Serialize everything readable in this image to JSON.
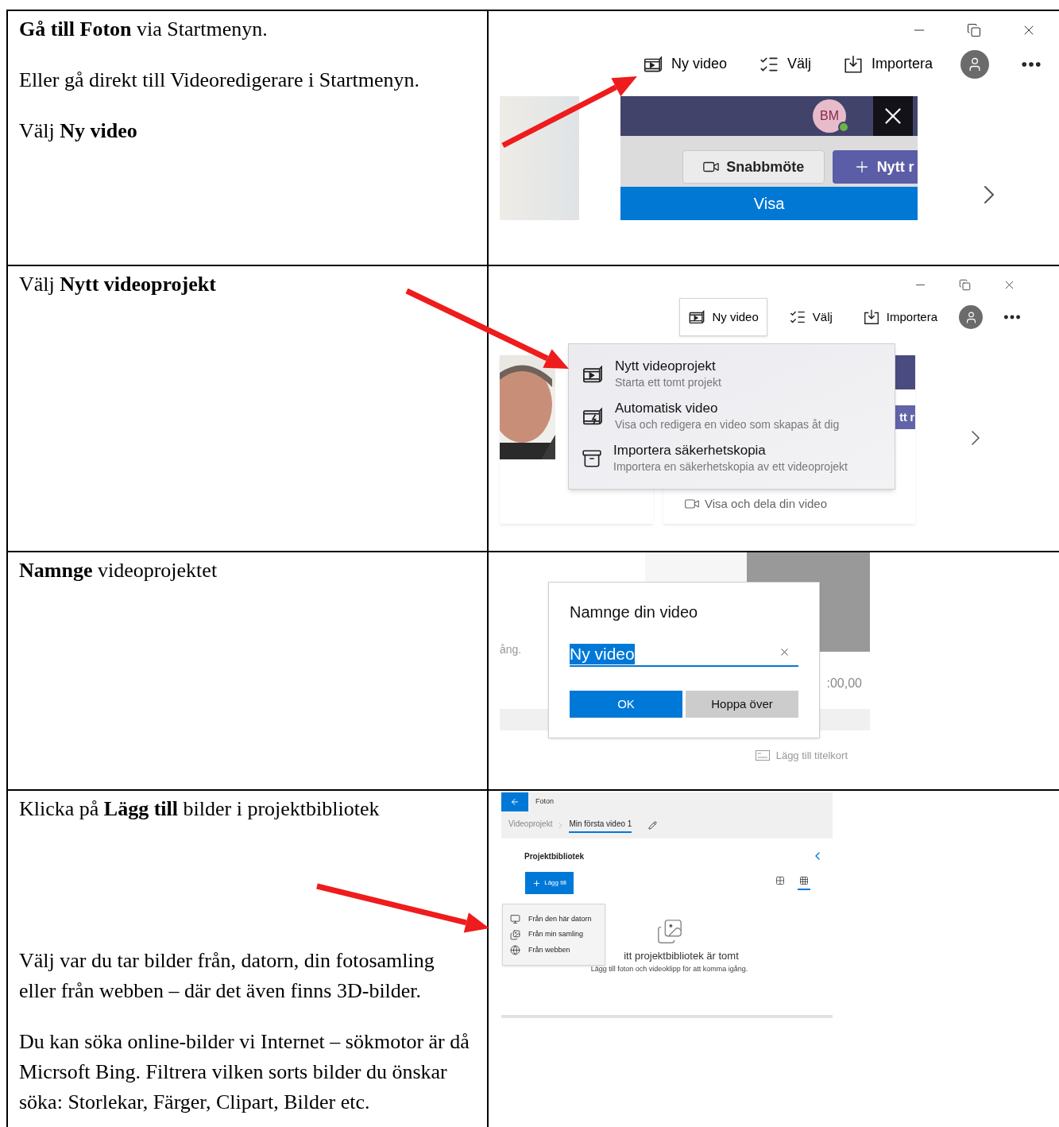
{
  "rows": [
    {
      "instructions": [
        "**Gå till Foton** via Startmenyn.",
        "Eller gå direkt till Videoredigerare i Startmenyn.",
        "Välj **Ny video**"
      ],
      "screenshot": {
        "kind": "toolbar",
        "toolbar": [
          {
            "kind": "video",
            "label": "Ny video",
            "selected": false
          },
          {
            "kind": "select",
            "label": "Välj",
            "selected": false
          },
          {
            "kind": "import",
            "label": "Importera",
            "selected": false
          }
        ],
        "thumbnail": {
          "avatar": "BM",
          "buttons": [
            "Snabbmöte",
            "Nytt r"
          ],
          "bar": "Visa"
        }
      }
    },
    {
      "instructions": [
        "Välj **Nytt videoprojekt**"
      ],
      "screenshot": {
        "kind": "menu",
        "toolbar": [
          {
            "kind": "video",
            "label": "Ny video",
            "selected": true
          },
          {
            "kind": "select",
            "label": "Välj",
            "selected": false
          },
          {
            "kind": "import",
            "label": "Importera",
            "selected": false
          }
        ],
        "menu": [
          {
            "kind": "video",
            "title": "Nytt videoprojekt",
            "subtitle": "Starta ett tomt projekt"
          },
          {
            "kind": "auto",
            "title": "Automatisk video",
            "subtitle": "Visa och redigera en video som skapas åt dig"
          },
          {
            "kind": "archive",
            "title": "Importera säkerhetskopia",
            "subtitle": "Importera en säkerhetskopia av ett videoprojekt"
          }
        ],
        "card_button": "tt r",
        "card_caption": "Visa och dela din video"
      }
    },
    {
      "instructions": [
        "**Namnge** videoprojektet"
      ],
      "screenshot": {
        "kind": "dialog",
        "side_text": "ång.",
        "timecode": ":00,00",
        "title_card": "Lägg till titelkort",
        "dialog": {
          "title": "Namnge din video",
          "value": "Ny video",
          "buttons": [
            {
              "kind": "primary",
              "label": "OK"
            },
            {
              "kind": "secondary",
              "label": "Hoppa över"
            }
          ]
        }
      }
    },
    {
      "instructions": [
        "Klicka på **Lägg till** bilder i projektbibliotek"
      ],
      "notes": [
        "Välj var du tar bilder från, datorn, din fotosamling eller från webben – där det även finns 3D-bilder.",
        "Du kan söka online-bilder vi Internet – sökmotor är då Micrsoft Bing. Filtrera vilken sorts bilder du önskar söka: Storlekar, Färger, Clipart, Bilder etc."
      ],
      "screenshot": {
        "kind": "library",
        "app_title": "Foton",
        "breadcrumb": [
          {
            "label": "Videoprojekt",
            "selected": false
          },
          {
            "label": "Min första video 1",
            "selected": true
          }
        ],
        "section": "Projektbibliotek",
        "add_button": "Lägg till",
        "views": [
          {
            "kind": "large",
            "selected": false
          },
          {
            "kind": "small",
            "selected": true
          }
        ],
        "menu": [
          {
            "kind": "computer",
            "label": "Från den här datorn"
          },
          {
            "kind": "collection",
            "label": "Från min samling"
          },
          {
            "kind": "web",
            "label": "Från webben"
          }
        ],
        "empty_title": "itt projektbibliotek är tomt",
        "empty_subtitle": "Lägg till foton och videoklipp för att komma igång."
      }
    }
  ]
}
